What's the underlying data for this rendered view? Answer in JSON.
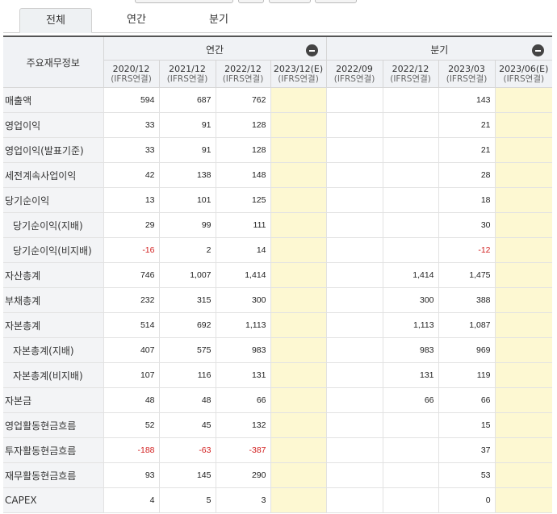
{
  "tabs": [
    "전체",
    "연간",
    "분기"
  ],
  "header": {
    "label_column": "주요재무정보",
    "groups": [
      "연간",
      "분기"
    ],
    "periods": [
      {
        "date": "2020/12",
        "basis": "(IFRS연결)"
      },
      {
        "date": "2021/12",
        "basis": "(IFRS연결)"
      },
      {
        "date": "2022/12",
        "basis": "(IFRS연결)"
      },
      {
        "date": "2023/12(E)",
        "basis": "(IFRS연결)"
      },
      {
        "date": "2022/09",
        "basis": "(IFRS연결)"
      },
      {
        "date": "2022/12",
        "basis": "(IFRS연결)"
      },
      {
        "date": "2023/03",
        "basis": "(IFRS연결)"
      },
      {
        "date": "2023/06(E)",
        "basis": "(IFRS연결)"
      }
    ]
  },
  "rows": [
    {
      "label": "매출액",
      "values": [
        "594",
        "687",
        "762",
        "",
        "",
        "",
        "143",
        ""
      ]
    },
    {
      "label": "영업이익",
      "values": [
        "33",
        "91",
        "128",
        "",
        "",
        "",
        "21",
        ""
      ]
    },
    {
      "label": "영업이익(발표기준)",
      "values": [
        "33",
        "91",
        "128",
        "",
        "",
        "",
        "21",
        ""
      ]
    },
    {
      "label": "세전계속사업이익",
      "values": [
        "42",
        "138",
        "148",
        "",
        "",
        "",
        "28",
        ""
      ]
    },
    {
      "label": "당기순이익",
      "values": [
        "13",
        "101",
        "125",
        "",
        "",
        "",
        "18",
        ""
      ]
    },
    {
      "label": "당기순이익(지배)",
      "values": [
        "29",
        "99",
        "111",
        "",
        "",
        "",
        "30",
        ""
      ]
    },
    {
      "label": "당기순이익(비지배)",
      "values": [
        "-16",
        "2",
        "14",
        "",
        "",
        "",
        "-12",
        ""
      ]
    },
    {
      "label": "자산총계",
      "values": [
        "746",
        "1,007",
        "1,414",
        "",
        "",
        "1,414",
        "1,475",
        ""
      ]
    },
    {
      "label": "부채총계",
      "values": [
        "232",
        "315",
        "300",
        "",
        "",
        "300",
        "388",
        ""
      ]
    },
    {
      "label": "자본총계",
      "values": [
        "514",
        "692",
        "1,113",
        "",
        "",
        "1,113",
        "1,087",
        ""
      ]
    },
    {
      "label": "자본총계(지배)",
      "values": [
        "407",
        "575",
        "983",
        "",
        "",
        "983",
        "969",
        ""
      ]
    },
    {
      "label": "자본총계(비지배)",
      "values": [
        "107",
        "116",
        "131",
        "",
        "",
        "131",
        "119",
        ""
      ]
    },
    {
      "label": "자본금",
      "values": [
        "48",
        "48",
        "66",
        "",
        "",
        "66",
        "66",
        ""
      ]
    },
    {
      "label": "영업활동현금흐름",
      "values": [
        "52",
        "45",
        "132",
        "",
        "",
        "",
        "15",
        ""
      ]
    },
    {
      "label": "투자활동현금흐름",
      "values": [
        "-188",
        "-63",
        "-387",
        "",
        "",
        "",
        "37",
        ""
      ]
    },
    {
      "label": "재무활동현금흐름",
      "values": [
        "93",
        "145",
        "290",
        "",
        "",
        "",
        "53",
        ""
      ]
    },
    {
      "label": "CAPEX",
      "values": [
        "4",
        "5",
        "3",
        "",
        "",
        "",
        "0",
        ""
      ]
    }
  ],
  "colors": {
    "negative": "#d21f1f",
    "estimate_bg": "#fdf8d2",
    "label_bg": "#f3f4f6"
  }
}
